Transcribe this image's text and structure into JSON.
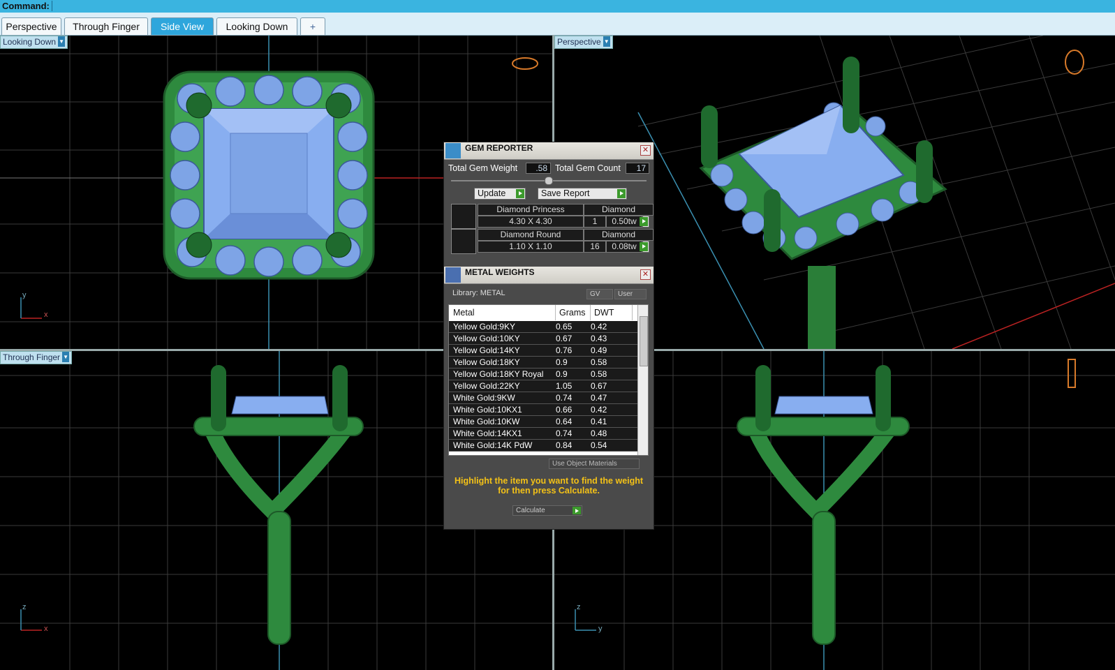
{
  "command": {
    "label": "Command:",
    "value": ""
  },
  "tabs": [
    {
      "label": "Perspective",
      "active": false
    },
    {
      "label": "Through Finger",
      "active": false
    },
    {
      "label": "Side View",
      "active": true
    },
    {
      "label": "Looking Down",
      "active": false
    },
    {
      "label": "+",
      "active": false
    }
  ],
  "viewports": {
    "top_left": {
      "label": "Looking Down",
      "axis_a": "y",
      "axis_b": "x"
    },
    "top_right": {
      "label": "Perspective"
    },
    "bottom_left": {
      "label": "Through Finger",
      "axis_a": "z",
      "axis_b": "x"
    },
    "bottom_right": {
      "label": "",
      "axis_a": "z",
      "axis_b": "y"
    }
  },
  "gem_reporter": {
    "title": "GEM REPORTER",
    "total_weight_label": "Total Gem Weight",
    "total_weight": ".58",
    "total_count_label": "Total Gem Count",
    "total_count": "17",
    "update_label": "Update",
    "save_label": "Save Report",
    "gems": [
      {
        "name": "Diamond Princess",
        "material": "Diamond",
        "size": "4.30 X 4.30",
        "count": "1",
        "weight": "0.50tw"
      },
      {
        "name": "Diamond Round",
        "material": "Diamond",
        "size": "1.10 X 1.10",
        "count": "16",
        "weight": "0.08tw"
      }
    ]
  },
  "metal_weights": {
    "title": "METAL WEIGHTS",
    "library": "Library: METAL",
    "gv_label": "GV",
    "user_label": "User",
    "headers": [
      "Metal",
      "Grams",
      "DWT"
    ],
    "rows": [
      [
        "Yellow Gold:9KY",
        "0.65",
        "0.42"
      ],
      [
        "Yellow Gold:10KY",
        "0.67",
        "0.43"
      ],
      [
        "Yellow Gold:14KY",
        "0.76",
        "0.49"
      ],
      [
        "Yellow Gold:18KY",
        "0.9",
        "0.58"
      ],
      [
        "Yellow Gold:18KY Royal",
        "0.9",
        "0.58"
      ],
      [
        "Yellow Gold:22KY",
        "1.05",
        "0.67"
      ],
      [
        "White Gold:9KW",
        "0.74",
        "0.47"
      ],
      [
        "White Gold:10KX1",
        "0.66",
        "0.42"
      ],
      [
        "White Gold:10KW",
        "0.64",
        "0.41"
      ],
      [
        "White Gold:14KX1",
        "0.74",
        "0.48"
      ],
      [
        "White Gold:14K PdW",
        "0.84",
        "0.54"
      ]
    ],
    "use_object_materials": "Use Object Materials",
    "hint": "Highlight the item you want to find the weight for then press Calculate.",
    "calculate_label": "Calculate"
  },
  "colors": {
    "metal": "#2e8a3e",
    "gem": "#7ea4e6",
    "accent": "#3ab4e0"
  }
}
